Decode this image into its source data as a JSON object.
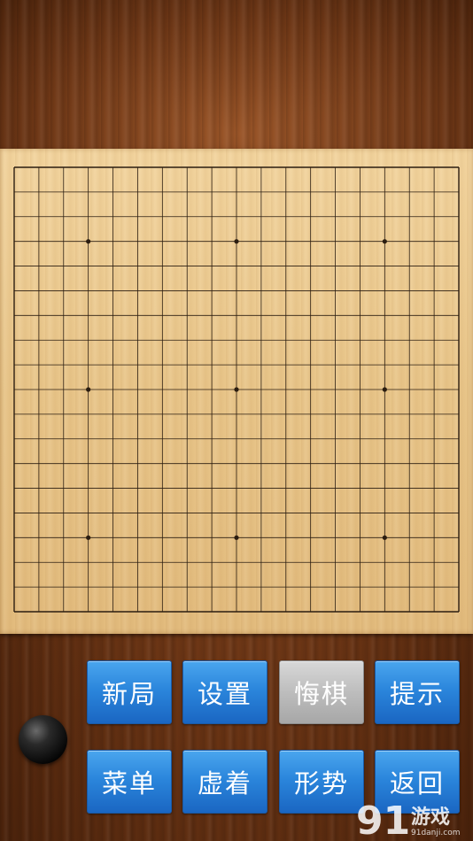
{
  "board": {
    "size": 19,
    "star_points": [
      [
        3,
        3
      ],
      [
        3,
        9
      ],
      [
        3,
        15
      ],
      [
        9,
        3
      ],
      [
        9,
        9
      ],
      [
        9,
        15
      ],
      [
        15,
        3
      ],
      [
        15,
        9
      ],
      [
        15,
        15
      ]
    ],
    "line_color": "#2b1d10"
  },
  "buttons": [
    {
      "label": "新局",
      "enabled": true
    },
    {
      "label": "设置",
      "enabled": true
    },
    {
      "label": "悔棋",
      "enabled": false
    },
    {
      "label": "提示",
      "enabled": true
    },
    {
      "label": "菜单",
      "enabled": true
    },
    {
      "label": "虚着",
      "enabled": true
    },
    {
      "label": "形势",
      "enabled": true
    },
    {
      "label": "返回",
      "enabled": true
    }
  ],
  "turn_indicator": {
    "color": "black"
  },
  "watermark": {
    "logo": "91",
    "text": "游戏",
    "domain": "91danji.com"
  },
  "colors": {
    "button_blue": "#2b86dc",
    "button_disabled": "#bdbdbd",
    "board": "#e9c68a",
    "wood": "#6a3414"
  }
}
